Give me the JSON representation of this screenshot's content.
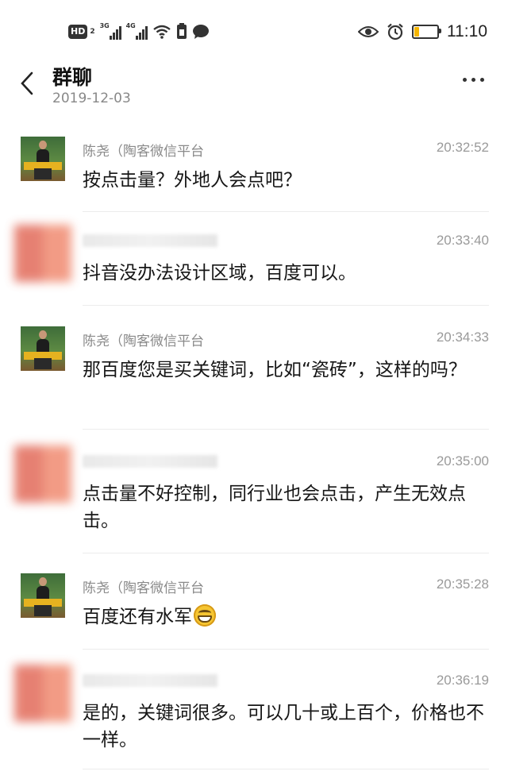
{
  "status_bar": {
    "hd_label": "HD",
    "hd_sub": "2",
    "net1": "3G",
    "net2": "4G",
    "time": "11:10",
    "battery_level": 0.2,
    "battery_color": "#f4b400"
  },
  "header": {
    "title": "群聊",
    "date": "2019-12-03"
  },
  "messages": [
    {
      "sender": "陈尧（陶客微信平台",
      "time": "20:32:52",
      "text": "按点击量？外地人会点吧？",
      "avatar": "photo"
    },
    {
      "sender": "",
      "time": "20:33:40",
      "text": "抖音没办法设计区域，百度可以。",
      "avatar": "blurred"
    },
    {
      "sender": "陈尧（陶客微信平台",
      "time": "20:34:33",
      "text": "那百度您是买关键词，比如“瓷砖”，这样的吗？",
      "avatar": "photo"
    },
    {
      "sender": "",
      "time": "20:35:00",
      "text": "点击量不好控制，同行业也会点击，产生无效点击。",
      "avatar": "blurred"
    },
    {
      "sender": "陈尧（陶客微信平台",
      "time": "20:35:28",
      "text": "百度还有水军",
      "avatar": "photo",
      "emoji": "grinning-face"
    },
    {
      "sender": "",
      "time": "20:36:19",
      "text": "是的，关键词很多。可以几十或上百个，价格也不一样。",
      "avatar": "blurred"
    }
  ]
}
